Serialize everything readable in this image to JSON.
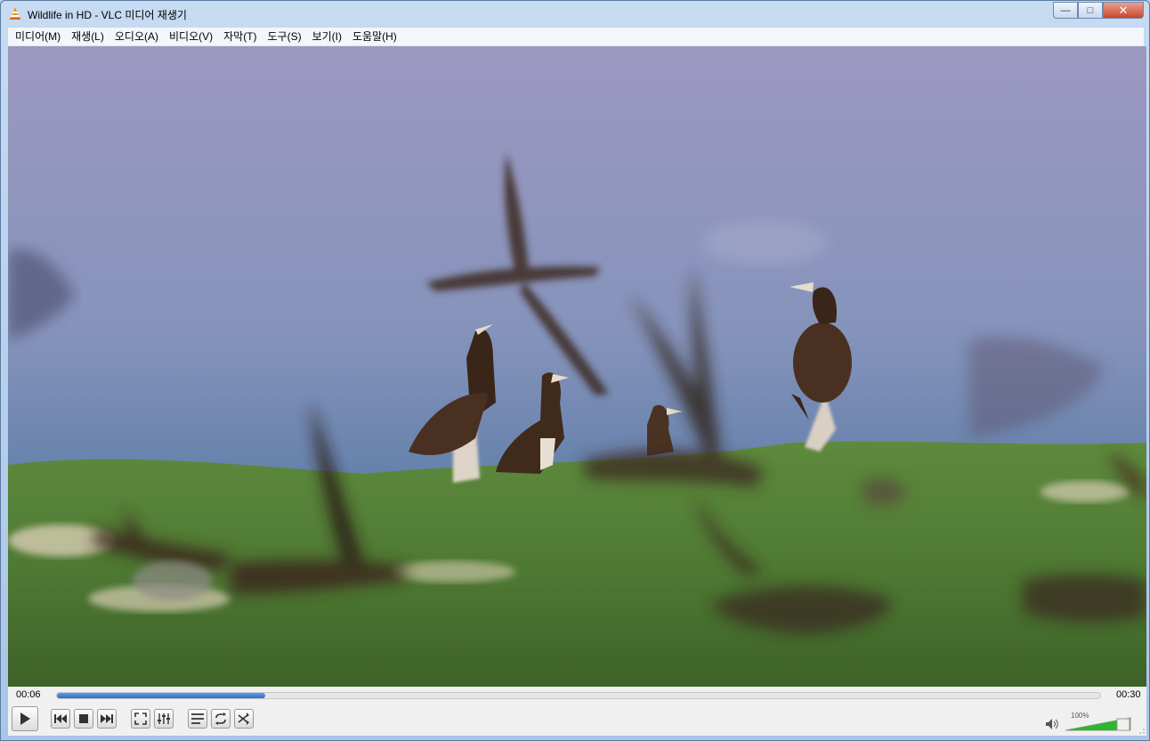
{
  "window": {
    "title": "Wildlife in HD - VLC 미디어 재생기"
  },
  "menu": {
    "items": [
      "미디어(M)",
      "재생(L)",
      "오디오(A)",
      "비디오(V)",
      "자막(T)",
      "도구(S)",
      "보기(I)",
      "도움말(H)"
    ]
  },
  "player": {
    "elapsed": "00:06",
    "total": "00:30",
    "progress_fraction": 0.2,
    "volume_label": "100%",
    "volume_fraction": 1.0
  },
  "icons": [
    "vlc-cone-icon",
    "play-icon",
    "previous-icon",
    "stop-icon",
    "next-icon",
    "fullscreen-icon",
    "extended-settings-icon",
    "playlist-icon",
    "loop-icon",
    "shuffle-icon",
    "speaker-icon"
  ],
  "colors": {
    "progress": "#2f6fc6",
    "volume": "#2fb52f"
  }
}
